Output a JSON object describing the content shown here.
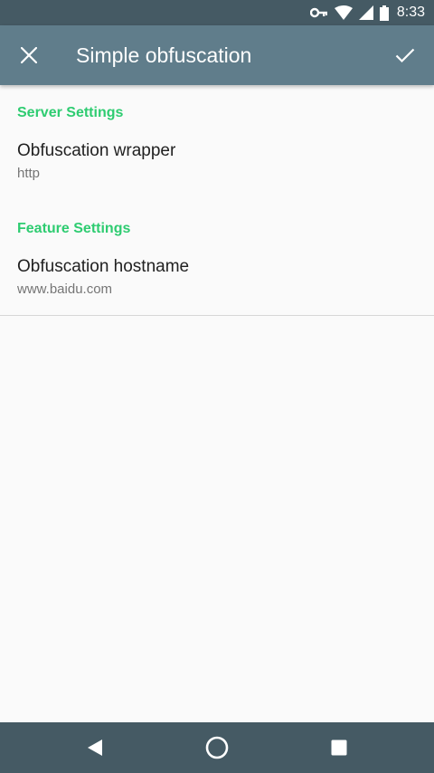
{
  "status_bar": {
    "time": "8:33",
    "icons": [
      "vpn-key-icon",
      "wifi-icon",
      "signal-icon",
      "battery-icon"
    ]
  },
  "toolbar": {
    "title": "Simple obfuscation",
    "close_icon": "close-icon",
    "confirm_icon": "check-icon",
    "background": "#607d8b"
  },
  "sections": [
    {
      "header": "Server Settings",
      "items": [
        {
          "title": "Obfuscation wrapper",
          "summary": "http"
        }
      ]
    },
    {
      "header": "Feature Settings",
      "items": [
        {
          "title": "Obfuscation hostname",
          "summary": "www.baidu.com"
        }
      ]
    }
  ],
  "colors": {
    "accent": "#2ecc71",
    "status_bar": "#455a64",
    "nav_bar": "#455a64",
    "background": "#fafafa"
  },
  "nav_bar": {
    "buttons": [
      "back-icon",
      "home-icon",
      "recents-icon"
    ]
  }
}
